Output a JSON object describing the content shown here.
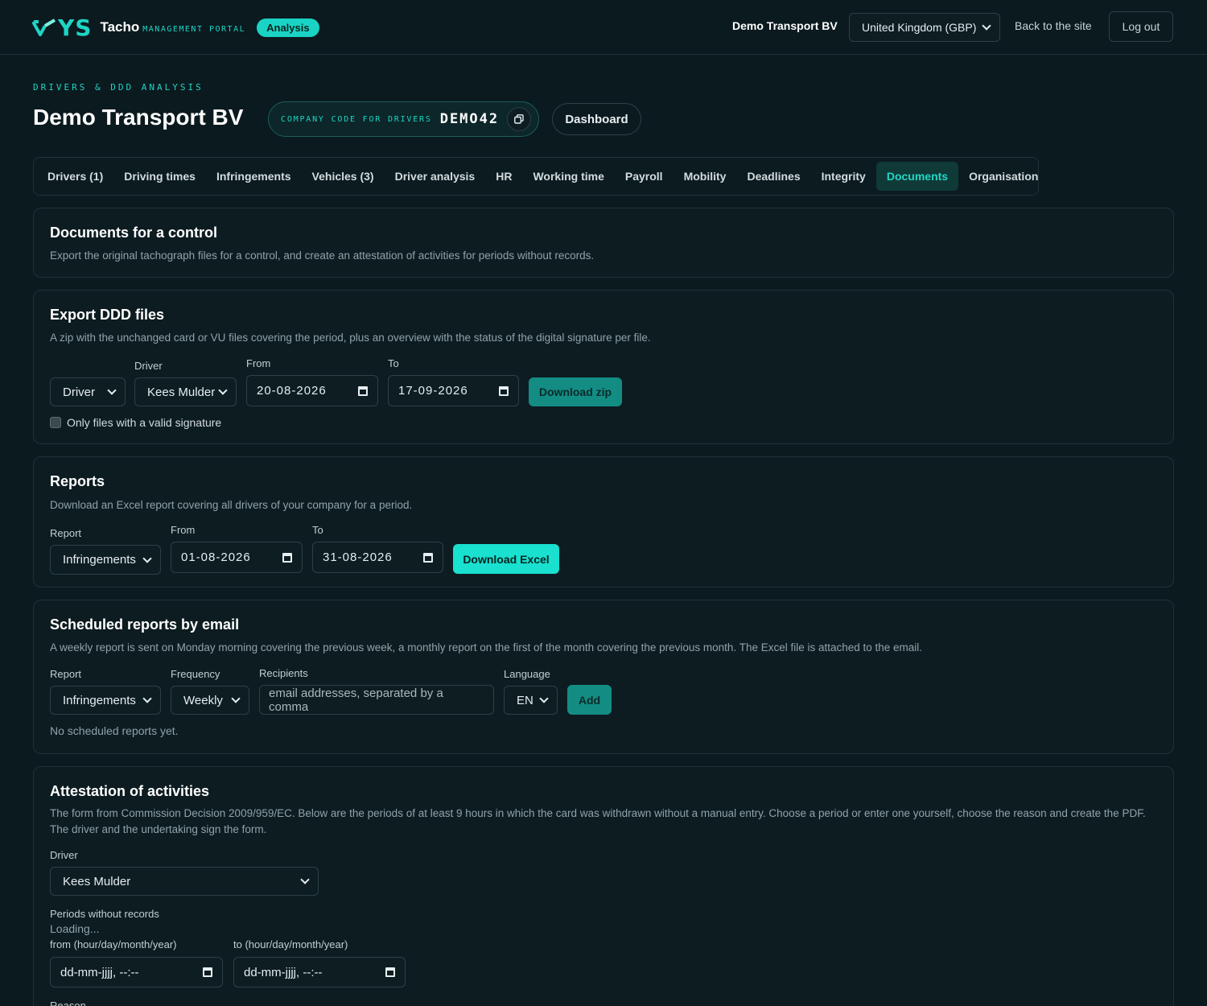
{
  "header": {
    "logo_text": "YS",
    "logo_name": "Tacho",
    "logo_sub": "MANAGEMENT PORTAL",
    "badge": "Analysis",
    "company": "Demo Transport BV",
    "region": "United Kingdom (GBP)",
    "back_link": "Back to the site",
    "logout": "Log out"
  },
  "page": {
    "kicker": "DRIVERS & DDD ANALYSIS",
    "title": "Demo Transport BV",
    "company_code_label": "COMPANY CODE FOR DRIVERS",
    "company_code": "DEMO42",
    "dashboard": "Dashboard"
  },
  "tabs": [
    {
      "label": "Drivers (1)"
    },
    {
      "label": "Driving times"
    },
    {
      "label": "Infringements"
    },
    {
      "label": "Vehicles (3)"
    },
    {
      "label": "Driver analysis"
    },
    {
      "label": "HR"
    },
    {
      "label": "Working time"
    },
    {
      "label": "Payroll"
    },
    {
      "label": "Mobility"
    },
    {
      "label": "Deadlines"
    },
    {
      "label": "Integrity"
    },
    {
      "label": "Documents"
    },
    {
      "label": "Organisation"
    }
  ],
  "control": {
    "title": "Documents for a control",
    "desc": "Export the original tachograph files for a control, and create an attestation of activities for periods without records."
  },
  "export": {
    "title": "Export DDD files",
    "desc": "A zip with the unchanged card or VU files covering the period, plus an overview with the status of the digital signature per file.",
    "type_value": "Driver",
    "driver_label": "Driver",
    "driver_value": "Kees Mulder",
    "from_label": "From",
    "from_value": "20-08-2026",
    "to_label": "To",
    "to_value": "17-09-2026",
    "button": "Download zip",
    "checkbox_label": "Only files with a valid signature"
  },
  "reports": {
    "title": "Reports",
    "desc": "Download an Excel report covering all drivers of your company for a period.",
    "report_label": "Report",
    "report_value": "Infringements",
    "from_label": "From",
    "from_value": "01-08-2026",
    "to_label": "To",
    "to_value": "31-08-2026",
    "button": "Download Excel"
  },
  "scheduled": {
    "title": "Scheduled reports by email",
    "desc": "A weekly report is sent on Monday morning covering the previous week, a monthly report on the first of the month covering the previous month. The Excel file is attached to the email.",
    "report_label": "Report",
    "report_value": "Infringements",
    "frequency_label": "Frequency",
    "frequency_value": "Weekly",
    "recipients_label": "Recipients",
    "recipients_placeholder": "email addresses, separated by a comma",
    "language_label": "Language",
    "language_value": "EN",
    "button": "Add",
    "empty": "No scheduled reports yet."
  },
  "attestation": {
    "title": "Attestation of activities",
    "desc": "The form from Commission Decision 2009/959/EC. Below are the periods of at least 9 hours in which the card was withdrawn without a manual entry. Choose a period or enter one yourself, choose the reason and create the PDF. The driver and the undertaking sign the form.",
    "driver_label": "Driver",
    "driver_value": "Kees Mulder",
    "periods_label": "Periods without records",
    "loading": "Loading...",
    "from_label": "from (hour/day/month/year)",
    "from_value": "dd-mm-jjjj, --:--",
    "to_label": "to (hour/day/month/year)",
    "to_value": "dd-mm-jjjj, --:--",
    "reason_label": "Reason"
  },
  "colors": {
    "accent": "#1fd4c4",
    "background": "#0b1a1f"
  }
}
